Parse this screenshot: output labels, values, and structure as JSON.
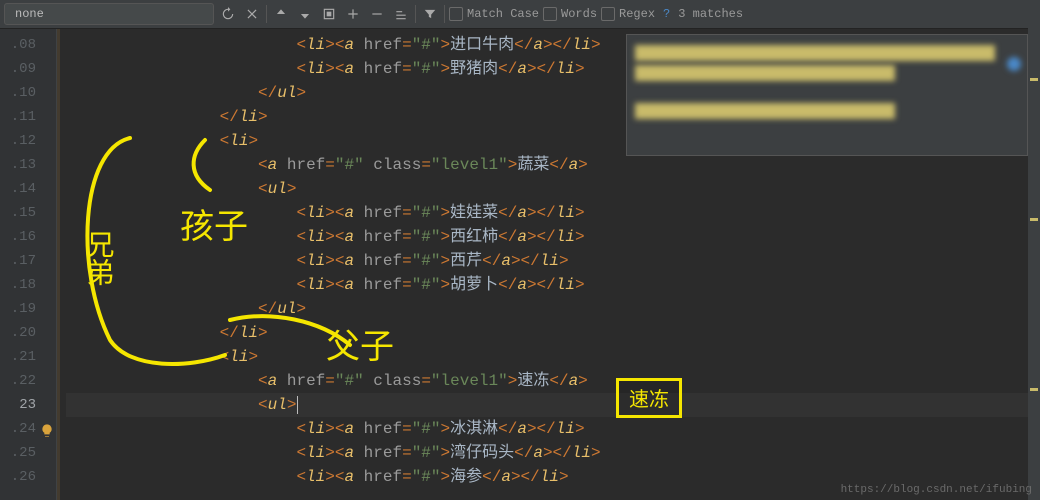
{
  "toolbar": {
    "search_value": "none",
    "match_case": "Match Case",
    "words": "Words",
    "regex": "Regex",
    "help": "?",
    "matches": "3 matches"
  },
  "gutter": {
    "start": 108,
    "rows": [
      ".08",
      ".09",
      ".10",
      ".11",
      ".12",
      ".13",
      ".14",
      ".15",
      ".16",
      ".17",
      ".18",
      ".19",
      ".20",
      ".21",
      ".22",
      "23",
      ".24",
      ".25",
      ".26"
    ],
    "active_index": 15
  },
  "code": {
    "lines": [
      {
        "indent": 24,
        "pre": true,
        "kind": "li_a",
        "text": "进口牛肉"
      },
      {
        "indent": 24,
        "pre": true,
        "kind": "li_a",
        "text": "野猪肉"
      },
      {
        "indent": 20,
        "pre": true,
        "kind": "close_ul"
      },
      {
        "indent": 16,
        "pre": true,
        "kind": "close_li"
      },
      {
        "indent": 16,
        "pre": true,
        "kind": "open_li"
      },
      {
        "indent": 20,
        "pre": true,
        "kind": "a_level1",
        "text": "蔬菜"
      },
      {
        "indent": 20,
        "pre": true,
        "kind": "open_ul"
      },
      {
        "indent": 24,
        "pre": true,
        "kind": "li_a",
        "text": "娃娃菜"
      },
      {
        "indent": 24,
        "pre": true,
        "kind": "li_a",
        "text": "西红柿"
      },
      {
        "indent": 24,
        "pre": true,
        "kind": "li_a",
        "text": "西芹"
      },
      {
        "indent": 24,
        "pre": true,
        "kind": "li_a",
        "text": "胡萝卜"
      },
      {
        "indent": 20,
        "pre": true,
        "kind": "close_ul"
      },
      {
        "indent": 16,
        "pre": true,
        "kind": "close_li"
      },
      {
        "indent": 16,
        "pre": true,
        "kind": "open_li"
      },
      {
        "indent": 20,
        "pre": true,
        "kind": "a_level1",
        "text": "速冻"
      },
      {
        "indent": 20,
        "pre": true,
        "kind": "open_ul",
        "caret": true,
        "active": true
      },
      {
        "indent": 24,
        "pre": true,
        "kind": "li_a",
        "text": "冰淇淋"
      },
      {
        "indent": 24,
        "pre": true,
        "kind": "li_a",
        "text": "湾仔码头"
      },
      {
        "indent": 24,
        "pre": true,
        "kind": "li_a",
        "text": "海参"
      }
    ]
  },
  "badge": "速冻",
  "watermark": "https://blog.csdn.net/ifubing",
  "annotations": {
    "sibling": "兄弟",
    "child": "孩子",
    "parent_child": "父子"
  }
}
